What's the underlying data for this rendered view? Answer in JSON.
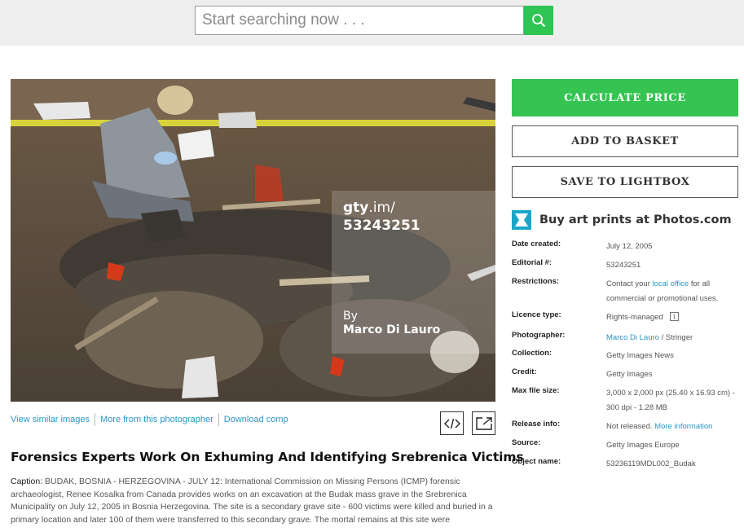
{
  "search": {
    "placeholder": "Start searching now . . ."
  },
  "icons": {
    "search": "search-icon",
    "embed": "code-embed-icon",
    "expand": "expand-icon",
    "photos": "photos-com-logo-icon",
    "info": "info-icon"
  },
  "colors": {
    "accent_green": "#35c452",
    "link_blue": "#2a96c9"
  },
  "overlay": {
    "gty": "gty",
    "im": ".im/",
    "id": "53243251",
    "by": "By",
    "photographer": "Marco Di Lauro"
  },
  "photo_links": {
    "similar": "View similar images",
    "more": "More from this photographer",
    "download": "Download comp"
  },
  "title": "Forensics Experts Work On Exhuming And Identifying Srebrenica Victims",
  "caption": {
    "label": "Caption:",
    "text": "BUDAK, BOSNIA - HERZEGOVINA - JULY 12: International Commission on Missing Persons (ICMP) forensic archaeologist, Renee Kosalka from Canada provides works on an excavation at the Budak mass grave in the Srebrenica Municipality on July 12, 2005 in Bosnia Herzegovina. The site is a secondary grave site - 600 victims were killed and buried in a primary location and later 100 of them were transferred to this secondary grave. The mortal remains at this site were"
  },
  "buttons": {
    "calculate": "CALCULATE PRICE",
    "basket": "ADD TO BASKET",
    "lightbox": "SAVE TO LIGHTBOX"
  },
  "artprints": "Buy art prints at Photos.com",
  "details": {
    "date_created": {
      "label": "Date created:",
      "value": "July 12, 2005"
    },
    "editorial": {
      "label": "Editorial #:",
      "value": "53243251"
    },
    "restrictions": {
      "label": "Restrictions:",
      "pre": "Contact your ",
      "link": "local office",
      "post": " for all commercial or promotional uses."
    },
    "licence": {
      "label": "Licence type:",
      "value": "Rights-managed",
      "info": "i"
    },
    "photographer": {
      "label": "Photographer:",
      "link": "Marco Di Lauro",
      "post": " / Stringer"
    },
    "collection": {
      "label": "Collection:",
      "value": "Getty Images News"
    },
    "credit": {
      "label": "Credit:",
      "value": "Getty Images"
    },
    "max_size": {
      "label": "Max file size:",
      "value": "3,000 x 2,000 px (25.40 x 16.93 cm) - 300 dpi - 1.28 MB"
    },
    "release": {
      "label": "Release info:",
      "value": "Not released.",
      "link": "More information"
    },
    "source": {
      "label": "Source:",
      "value": "Getty Images Europe"
    },
    "object": {
      "label": "Object name:",
      "value": "53236119MDL002_Budak"
    }
  }
}
